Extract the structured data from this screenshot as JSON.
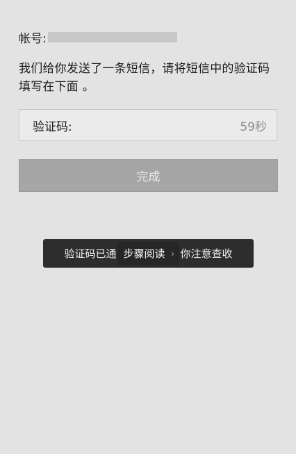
{
  "account": {
    "label": "帐号:"
  },
  "message": {
    "text": "我们给你发送了一条短信，请将短信中的验证码填写在下面 。"
  },
  "code": {
    "label": "验证码:",
    "value": "",
    "countdown": "59秒"
  },
  "submit": {
    "label": "完成"
  },
  "toast": {
    "prefix": "验证码已通",
    "overlay_label": "步骤阅读",
    "suffix": "你注意查收"
  },
  "icons": {
    "chevron": "chevron-right-icon"
  }
}
